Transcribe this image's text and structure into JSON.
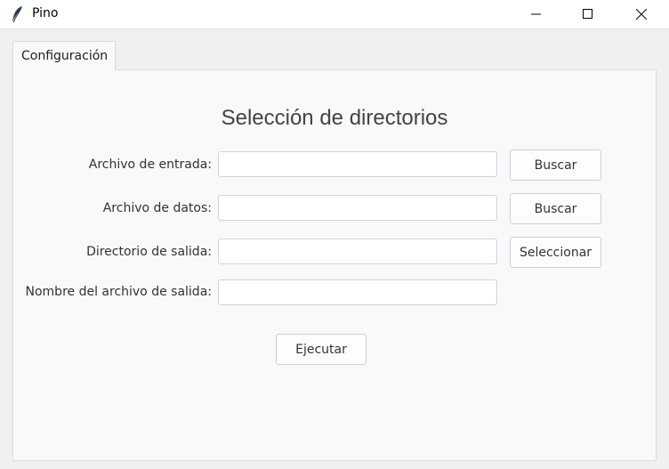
{
  "window": {
    "title": "Pino",
    "icon": "feather-icon",
    "controls": [
      "minimize-icon",
      "maximize-icon",
      "close-icon"
    ]
  },
  "tabs": [
    {
      "label": "Configuración",
      "selected": true
    }
  ],
  "main": {
    "heading": "Selección de directorios",
    "rows": [
      {
        "label": "Archivo de entrada:",
        "value": "",
        "button": "Buscar"
      },
      {
        "label": "Archivo de datos:",
        "value": "",
        "button": "Buscar"
      },
      {
        "label": "Directorio de salida:",
        "value": "",
        "button": "Seleccionar"
      },
      {
        "label": "Nombre del archivo de salida:",
        "value": ""
      }
    ],
    "run_button": "Ejecutar"
  }
}
